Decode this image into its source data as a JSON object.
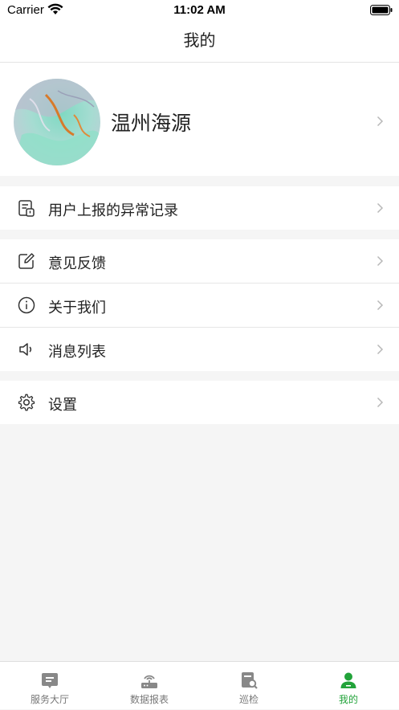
{
  "status_bar": {
    "carrier": "Carrier",
    "time": "11:02 AM"
  },
  "nav": {
    "title": "我的"
  },
  "profile": {
    "name": "温州海源"
  },
  "menu": {
    "abnormal_records": "用户上报的异常记录",
    "feedback": "意见反馈",
    "about": "关于我们",
    "messages": "消息列表",
    "settings": "设置"
  },
  "tabs": [
    {
      "label": "服务大厅",
      "icon": "service-hall-icon"
    },
    {
      "label": "数据报表",
      "icon": "data-report-icon"
    },
    {
      "label": "巡检",
      "icon": "inspection-icon"
    },
    {
      "label": "我的",
      "icon": "profile-person-icon"
    }
  ],
  "colors": {
    "accent": "#22a33a",
    "inactive": "#777777",
    "background": "#f5f5f5"
  }
}
